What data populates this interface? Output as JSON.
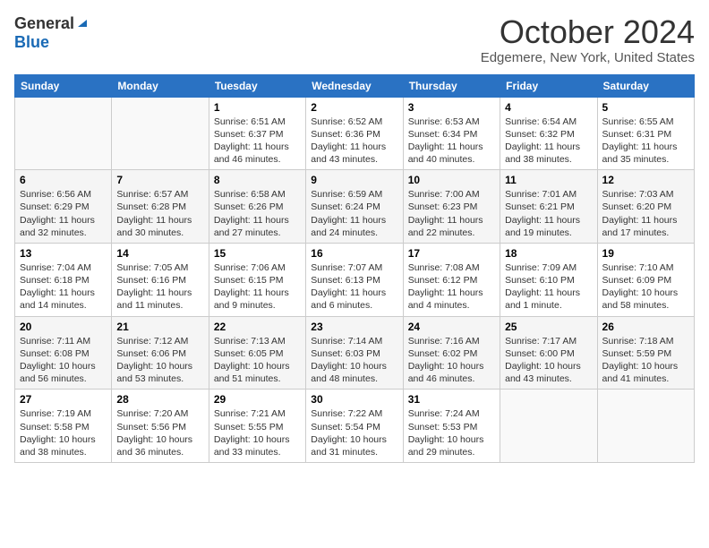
{
  "header": {
    "logo_general": "General",
    "logo_blue": "Blue",
    "month_title": "October 2024",
    "location": "Edgemere, New York, United States"
  },
  "days_of_week": [
    "Sunday",
    "Monday",
    "Tuesday",
    "Wednesday",
    "Thursday",
    "Friday",
    "Saturday"
  ],
  "weeks": [
    [
      {
        "day": "",
        "sunrise": "",
        "sunset": "",
        "daylight": ""
      },
      {
        "day": "",
        "sunrise": "",
        "sunset": "",
        "daylight": ""
      },
      {
        "day": "1",
        "sunrise": "Sunrise: 6:51 AM",
        "sunset": "Sunset: 6:37 PM",
        "daylight": "Daylight: 11 hours and 46 minutes."
      },
      {
        "day": "2",
        "sunrise": "Sunrise: 6:52 AM",
        "sunset": "Sunset: 6:36 PM",
        "daylight": "Daylight: 11 hours and 43 minutes."
      },
      {
        "day": "3",
        "sunrise": "Sunrise: 6:53 AM",
        "sunset": "Sunset: 6:34 PM",
        "daylight": "Daylight: 11 hours and 40 minutes."
      },
      {
        "day": "4",
        "sunrise": "Sunrise: 6:54 AM",
        "sunset": "Sunset: 6:32 PM",
        "daylight": "Daylight: 11 hours and 38 minutes."
      },
      {
        "day": "5",
        "sunrise": "Sunrise: 6:55 AM",
        "sunset": "Sunset: 6:31 PM",
        "daylight": "Daylight: 11 hours and 35 minutes."
      }
    ],
    [
      {
        "day": "6",
        "sunrise": "Sunrise: 6:56 AM",
        "sunset": "Sunset: 6:29 PM",
        "daylight": "Daylight: 11 hours and 32 minutes."
      },
      {
        "day": "7",
        "sunrise": "Sunrise: 6:57 AM",
        "sunset": "Sunset: 6:28 PM",
        "daylight": "Daylight: 11 hours and 30 minutes."
      },
      {
        "day": "8",
        "sunrise": "Sunrise: 6:58 AM",
        "sunset": "Sunset: 6:26 PM",
        "daylight": "Daylight: 11 hours and 27 minutes."
      },
      {
        "day": "9",
        "sunrise": "Sunrise: 6:59 AM",
        "sunset": "Sunset: 6:24 PM",
        "daylight": "Daylight: 11 hours and 24 minutes."
      },
      {
        "day": "10",
        "sunrise": "Sunrise: 7:00 AM",
        "sunset": "Sunset: 6:23 PM",
        "daylight": "Daylight: 11 hours and 22 minutes."
      },
      {
        "day": "11",
        "sunrise": "Sunrise: 7:01 AM",
        "sunset": "Sunset: 6:21 PM",
        "daylight": "Daylight: 11 hours and 19 minutes."
      },
      {
        "day": "12",
        "sunrise": "Sunrise: 7:03 AM",
        "sunset": "Sunset: 6:20 PM",
        "daylight": "Daylight: 11 hours and 17 minutes."
      }
    ],
    [
      {
        "day": "13",
        "sunrise": "Sunrise: 7:04 AM",
        "sunset": "Sunset: 6:18 PM",
        "daylight": "Daylight: 11 hours and 14 minutes."
      },
      {
        "day": "14",
        "sunrise": "Sunrise: 7:05 AM",
        "sunset": "Sunset: 6:16 PM",
        "daylight": "Daylight: 11 hours and 11 minutes."
      },
      {
        "day": "15",
        "sunrise": "Sunrise: 7:06 AM",
        "sunset": "Sunset: 6:15 PM",
        "daylight": "Daylight: 11 hours and 9 minutes."
      },
      {
        "day": "16",
        "sunrise": "Sunrise: 7:07 AM",
        "sunset": "Sunset: 6:13 PM",
        "daylight": "Daylight: 11 hours and 6 minutes."
      },
      {
        "day": "17",
        "sunrise": "Sunrise: 7:08 AM",
        "sunset": "Sunset: 6:12 PM",
        "daylight": "Daylight: 11 hours and 4 minutes."
      },
      {
        "day": "18",
        "sunrise": "Sunrise: 7:09 AM",
        "sunset": "Sunset: 6:10 PM",
        "daylight": "Daylight: 11 hours and 1 minute."
      },
      {
        "day": "19",
        "sunrise": "Sunrise: 7:10 AM",
        "sunset": "Sunset: 6:09 PM",
        "daylight": "Daylight: 10 hours and 58 minutes."
      }
    ],
    [
      {
        "day": "20",
        "sunrise": "Sunrise: 7:11 AM",
        "sunset": "Sunset: 6:08 PM",
        "daylight": "Daylight: 10 hours and 56 minutes."
      },
      {
        "day": "21",
        "sunrise": "Sunrise: 7:12 AM",
        "sunset": "Sunset: 6:06 PM",
        "daylight": "Daylight: 10 hours and 53 minutes."
      },
      {
        "day": "22",
        "sunrise": "Sunrise: 7:13 AM",
        "sunset": "Sunset: 6:05 PM",
        "daylight": "Daylight: 10 hours and 51 minutes."
      },
      {
        "day": "23",
        "sunrise": "Sunrise: 7:14 AM",
        "sunset": "Sunset: 6:03 PM",
        "daylight": "Daylight: 10 hours and 48 minutes."
      },
      {
        "day": "24",
        "sunrise": "Sunrise: 7:16 AM",
        "sunset": "Sunset: 6:02 PM",
        "daylight": "Daylight: 10 hours and 46 minutes."
      },
      {
        "day": "25",
        "sunrise": "Sunrise: 7:17 AM",
        "sunset": "Sunset: 6:00 PM",
        "daylight": "Daylight: 10 hours and 43 minutes."
      },
      {
        "day": "26",
        "sunrise": "Sunrise: 7:18 AM",
        "sunset": "Sunset: 5:59 PM",
        "daylight": "Daylight: 10 hours and 41 minutes."
      }
    ],
    [
      {
        "day": "27",
        "sunrise": "Sunrise: 7:19 AM",
        "sunset": "Sunset: 5:58 PM",
        "daylight": "Daylight: 10 hours and 38 minutes."
      },
      {
        "day": "28",
        "sunrise": "Sunrise: 7:20 AM",
        "sunset": "Sunset: 5:56 PM",
        "daylight": "Daylight: 10 hours and 36 minutes."
      },
      {
        "day": "29",
        "sunrise": "Sunrise: 7:21 AM",
        "sunset": "Sunset: 5:55 PM",
        "daylight": "Daylight: 10 hours and 33 minutes."
      },
      {
        "day": "30",
        "sunrise": "Sunrise: 7:22 AM",
        "sunset": "Sunset: 5:54 PM",
        "daylight": "Daylight: 10 hours and 31 minutes."
      },
      {
        "day": "31",
        "sunrise": "Sunrise: 7:24 AM",
        "sunset": "Sunset: 5:53 PM",
        "daylight": "Daylight: 10 hours and 29 minutes."
      },
      {
        "day": "",
        "sunrise": "",
        "sunset": "",
        "daylight": ""
      },
      {
        "day": "",
        "sunrise": "",
        "sunset": "",
        "daylight": ""
      }
    ]
  ]
}
